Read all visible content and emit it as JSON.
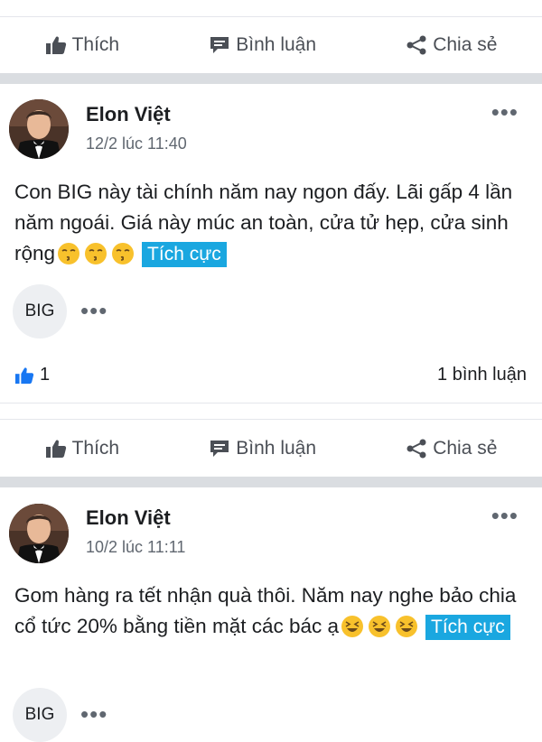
{
  "actions": {
    "like": "Thích",
    "comment": "Bình luận",
    "share": "Chia sẻ"
  },
  "posts": [
    {
      "author": "Elon Việt",
      "timestamp": "12/2 lúc 11:40",
      "text": "Con BIG này tài chính năm nay ngon đấy. Lãi gấp 4 lần năm ngoái. Giá này múc an toàn, cửa tử hẹp, cửa sinh rộng",
      "emojis": [
        "kissing-face-icon",
        "kissing-face-icon",
        "kissing-face-icon"
      ],
      "sentiment": "Tích cực",
      "ticker": "BIG",
      "like_count": "1",
      "comment_count": "1 bình luận"
    },
    {
      "author": "Elon Việt",
      "timestamp": "10/2 lúc 11:11",
      "text": "Gom hàng ra tết nhận quà thôi. Năm nay nghe bảo chia cổ tức 20% bằng tiền mặt các bác ạ",
      "emojis": [
        "laughing-face-icon",
        "laughing-face-icon",
        "laughing-face-icon"
      ],
      "sentiment": "Tích cực",
      "ticker": "BIG"
    }
  ],
  "more_glyph": "•••",
  "colors": {
    "sentiment_tag": "#1aa7e0",
    "like_icon": "#1877f2",
    "separator": "#dadde1",
    "secondary_text": "#606770"
  }
}
